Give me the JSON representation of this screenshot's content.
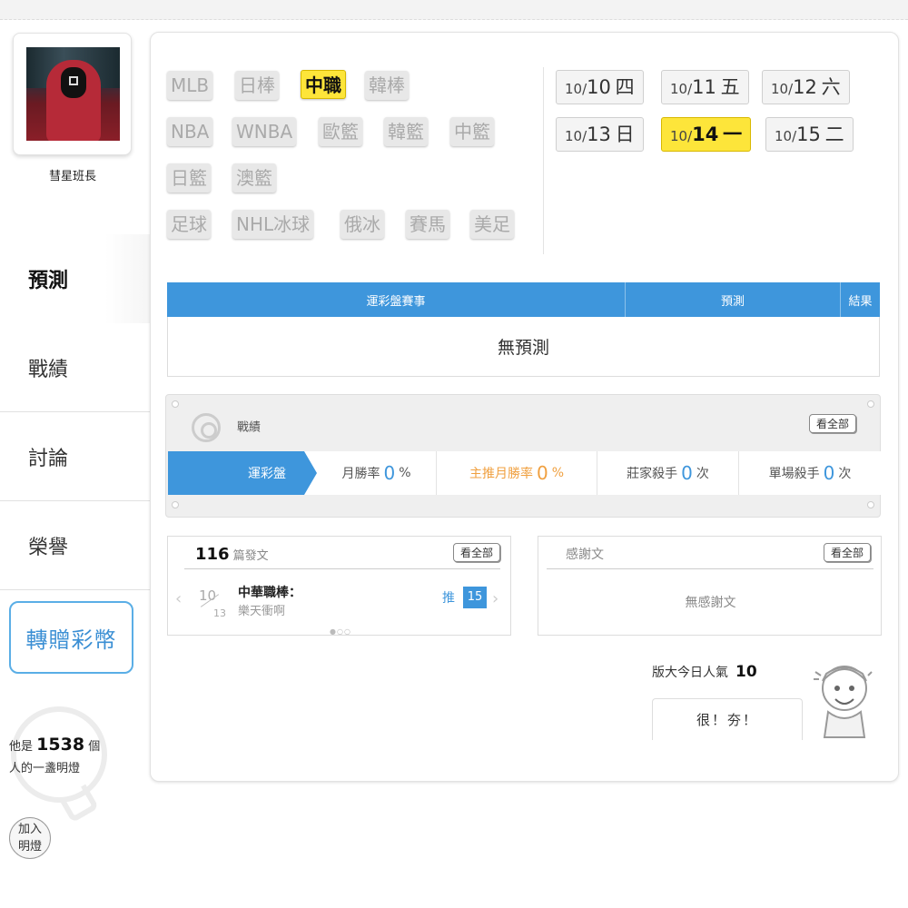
{
  "user": {
    "name": "彗星班長"
  },
  "nav": [
    {
      "label": "預測",
      "active": true
    },
    {
      "label": "戰績",
      "active": false
    },
    {
      "label": "討論",
      "active": false
    },
    {
      "label": "榮譽",
      "active": false
    }
  ],
  "gift_button": "轉贈彩幣",
  "lamp": {
    "prefix": "他是",
    "count": "1538",
    "suffix": "個",
    "line2": "人的一盞明燈",
    "join_line1": "加入",
    "join_line2": "明燈"
  },
  "sports": {
    "row1": [
      "MLB",
      "日棒",
      "中職",
      "韓棒"
    ],
    "row2": [
      "NBA",
      "WNBA",
      "歐籃",
      "韓籃",
      "中籃"
    ],
    "row3": [
      "日籃",
      "澳籃"
    ],
    "row4": [
      "足球",
      "NHL冰球",
      "俄冰",
      "賽馬",
      "美足"
    ],
    "active": "中職"
  },
  "dates": [
    {
      "month": "10/",
      "day": "10",
      "weekday": "四",
      "active": false
    },
    {
      "month": "10/",
      "day": "11",
      "weekday": "五",
      "active": false
    },
    {
      "month": "10/",
      "day": "12",
      "weekday": "六",
      "active": false
    },
    {
      "month": "10/",
      "day": "13",
      "weekday": "日",
      "active": false
    },
    {
      "month": "10/",
      "day": "14",
      "weekday": "一",
      "active": true
    },
    {
      "month": "10/",
      "day": "15",
      "weekday": "二",
      "active": false
    }
  ],
  "prediction_table": {
    "headers": [
      "運彩盤賽事",
      "預測",
      "結果"
    ],
    "empty": "無預測"
  },
  "record": {
    "title": "戰績",
    "view_all": "看全部",
    "tab": "運彩盤",
    "stats": [
      {
        "label": "月勝率",
        "value": "0",
        "unit": "%"
      },
      {
        "label": "主推月勝率",
        "value": "0",
        "unit": "%"
      },
      {
        "label": "莊家殺手",
        "value": "0",
        "unit": "次"
      },
      {
        "label": "單場殺手",
        "value": "0",
        "unit": "次"
      }
    ]
  },
  "posts": {
    "count": "116",
    "label": "篇發文",
    "view_all": "看全部",
    "item": {
      "month": "10",
      "day": "13",
      "title": "中華職棒：",
      "subtitle": "樂天衝啊",
      "push_label": "推",
      "push_count": "15"
    }
  },
  "thanks": {
    "title": "感謝文",
    "view_all": "看全部",
    "empty": "無感謝文"
  },
  "popularity": {
    "label": "版大今日人氣",
    "value": "10",
    "bubble": "很！夯！"
  }
}
